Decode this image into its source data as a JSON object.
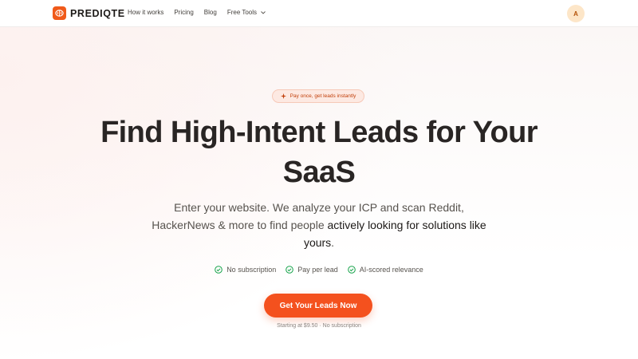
{
  "nav": {
    "brand": "PREDIQTE",
    "links": [
      "How it works",
      "Pricing",
      "Blog",
      "Free Tools"
    ],
    "avatar_initial": "A"
  },
  "hero": {
    "badge": "Pay once, get leads instantly",
    "headline_line1": "Find High-Intent Leads for Your",
    "headline_line2": "SaaS",
    "sub_plain": "Enter your website. We analyze your ICP and scan Reddit, HackerNews & more to find people ",
    "sub_bold": "actively looking for solutions like yours",
    "sub_end": ".",
    "features": [
      "No subscription",
      "Pay per lead",
      "AI-scored relevance"
    ],
    "cta": "Get Your Leads Now",
    "fine_print": "Starting at $9.50 · No subscription"
  },
  "colors": {
    "accent": "#f4511e",
    "check": "#16a34a",
    "avatar_bg": "#fde6c8"
  },
  "icons": {
    "logo": "brain-logo-icon",
    "badge": "sparkle-icon",
    "feature": "check-circle-icon",
    "dropdown": "chevron-down-icon"
  }
}
